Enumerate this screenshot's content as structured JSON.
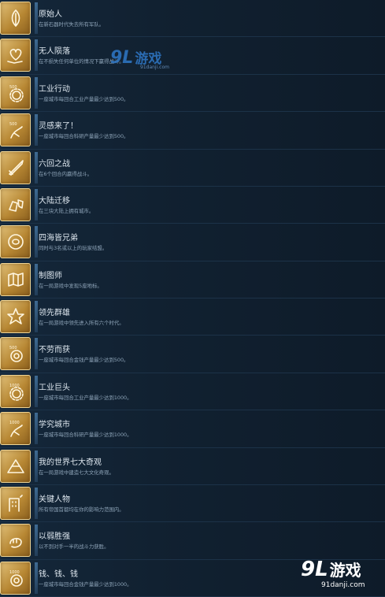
{
  "achievements": [
    {
      "title": "原始人",
      "desc": "在新石器时代失去所有军队。",
      "icon": "shell-icon"
    },
    {
      "title": "无人陨落",
      "desc": "在不损失任何单位的情况下赢得战斗。",
      "icon": "heart-hand-icon"
    },
    {
      "title": "工业行动",
      "desc": "一座城市每回合工业产量最少达到500。",
      "icon": "gear-500-icon"
    },
    {
      "title": "灵感来了！",
      "desc": "一座城市每回合科研产量最少达到500。",
      "icon": "science-500-icon"
    },
    {
      "title": "六回之战",
      "desc": "在6个回合内赢得战斗。",
      "icon": "sword-icon"
    },
    {
      "title": "大陆迁移",
      "desc": "在三块大陆上拥有城市。",
      "icon": "continents-icon"
    },
    {
      "title": "四海皆兄弟",
      "desc": "同时与3名或以上的玩家结盟。",
      "icon": "alliance-icon"
    },
    {
      "title": "制图师",
      "desc": "在一局游戏中发现5座地标。",
      "icon": "map-icon"
    },
    {
      "title": "领先群雄",
      "desc": "在一局游戏中领先进入所有六个时代。",
      "icon": "star-icon"
    },
    {
      "title": "不劳而获",
      "desc": "一座城市每回合金钱产量最少达到500。",
      "icon": "coin-500-icon"
    },
    {
      "title": "工业巨头",
      "desc": "一座城市每回合工业产量最少达到1000。",
      "icon": "gear-1000-icon"
    },
    {
      "title": "学究城市",
      "desc": "一座城市每回合科研产量最少达到1000。",
      "icon": "science-1000-icon"
    },
    {
      "title": "我的世界七大奇观",
      "desc": "在一局游戏中建造七大文化奇观。",
      "icon": "pyramid-icon"
    },
    {
      "title": "关键人物",
      "desc": "所有帝国首都均在你的影响力范围内。",
      "icon": "building-icon"
    },
    {
      "title": "以弱胜强",
      "desc": "以不到对手一半的战斗力获胜。",
      "icon": "fist-icon"
    },
    {
      "title": "钱、钱、钱",
      "desc": "一座城市每回合金钱产量最少达到1000。",
      "icon": "coin-1000-icon"
    }
  ],
  "watermark_top": {
    "logo": "9L",
    "text": "游戏",
    "url": "91danji.com"
  },
  "watermark_bottom": {
    "logo": "9L",
    "text": "游戏",
    "url": "91danji.com"
  }
}
